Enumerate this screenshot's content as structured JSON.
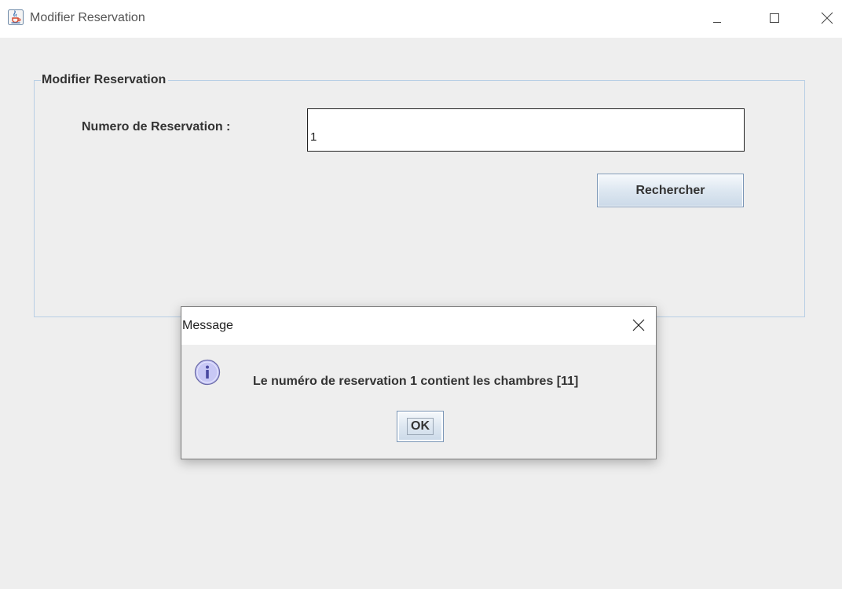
{
  "window": {
    "title": "Modifier Reservation",
    "icons": {
      "app": "java-coffee-cup-icon",
      "minimize": "minimize-icon",
      "maximize": "maximize-icon",
      "close": "close-icon"
    }
  },
  "form": {
    "group_title": "Modifier Reservation",
    "field_label": "Numero de Reservation :",
    "field_value": "1",
    "search_button": "Rechercher"
  },
  "dialog": {
    "title": "Message",
    "icon": "info-icon",
    "message": "Le numéro de reservation 1 contient les chambres [11]",
    "ok_button": "OK"
  },
  "colors": {
    "background": "#eeeeee",
    "titlebar": "#ffffff",
    "group_border": "#b8cfe5",
    "button_border": "#7a96b6",
    "info_icon": "#c8c8f5"
  }
}
